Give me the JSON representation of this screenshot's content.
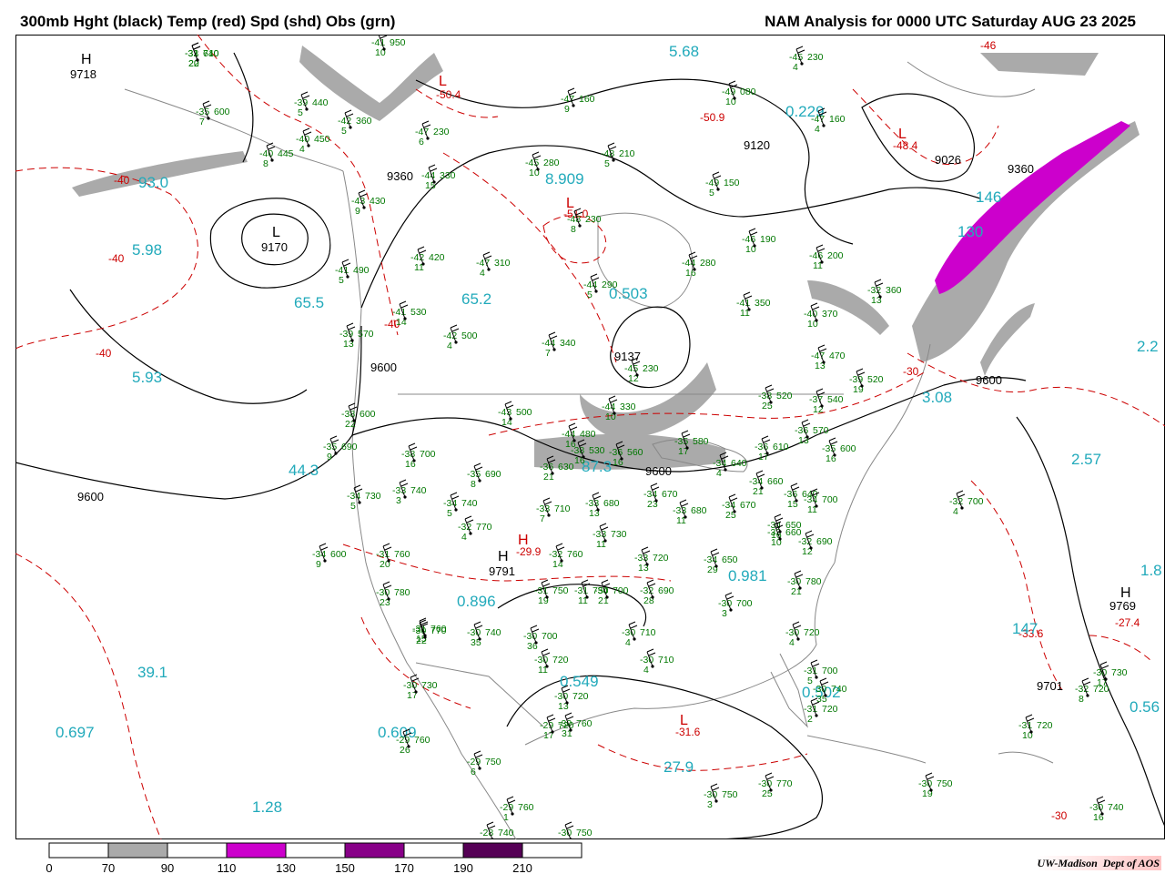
{
  "header": {
    "left_title": "300mb Hght (black) Temp (red) Spd (shd) Obs (grn)",
    "right_title": "NAM Analysis for 0000 UTC Saturday  AUG 23 2025"
  },
  "credit": {
    "org": "UW-Madison",
    "dept": "Dept of AOS"
  },
  "colors": {
    "height_contour": "#000000",
    "temp_contour": "#cc0000",
    "speed_70_90": "#aaaaaa",
    "speed_110_130": "#cc00cc",
    "speed_150_170": "#880088",
    "speed_190_210": "#550055",
    "obs": "#007700",
    "speed_label": "#22aabb",
    "geography": "#888888"
  },
  "scale_bar": {
    "labels": [
      "0",
      "70",
      "90",
      "110",
      "130",
      "150",
      "170",
      "190",
      "210"
    ],
    "segment_colors": [
      "#ffffff",
      "#aaaaaa",
      "#ffffff",
      "#cc00cc",
      "#ffffff",
      "#880088",
      "#ffffff",
      "#550055",
      "#ffffff"
    ]
  },
  "height_labels": [
    {
      "text": "9718"
    },
    {
      "text": "9360"
    },
    {
      "text": "9170"
    },
    {
      "text": "9600"
    },
    {
      "text": "9600"
    },
    {
      "text": "9137"
    },
    {
      "text": "9120"
    },
    {
      "text": "9026"
    },
    {
      "text": "9360"
    },
    {
      "text": "9600"
    },
    {
      "text": "9600"
    },
    {
      "text": "9791"
    },
    {
      "text": "9701"
    },
    {
      "text": "9769"
    }
  ],
  "hl_markers": [
    {
      "text": "H",
      "kind": "height"
    },
    {
      "text": "L",
      "kind": "height"
    },
    {
      "text": "H",
      "kind": "height"
    },
    {
      "text": "H",
      "kind": "height"
    },
    {
      "text": "L",
      "kind": "temp"
    },
    {
      "text": "L",
      "kind": "temp"
    },
    {
      "text": "H",
      "kind": "temp"
    },
    {
      "text": "L",
      "kind": "temp"
    },
    {
      "text": "L",
      "kind": "temp"
    }
  ],
  "temp_labels": [
    {
      "text": "-40"
    },
    {
      "text": "-40"
    },
    {
      "text": "-40"
    },
    {
      "text": "-40"
    },
    {
      "text": "-50.4"
    },
    {
      "text": "-50.9"
    },
    {
      "text": "-51.0"
    },
    {
      "text": "-48.4"
    },
    {
      "text": "-46"
    },
    {
      "text": "-29.9"
    },
    {
      "text": "-31.6"
    },
    {
      "text": "-33.6"
    },
    {
      "text": "-27.4"
    },
    {
      "text": "-30"
    },
    {
      "text": "-30"
    }
  ],
  "speed_labels": [
    {
      "text": "93.0"
    },
    {
      "text": "5.98"
    },
    {
      "text": "65.5"
    },
    {
      "text": "5.93"
    },
    {
      "text": "65.2"
    },
    {
      "text": "8.909"
    },
    {
      "text": "0.229"
    },
    {
      "text": "146"
    },
    {
      "text": "130"
    },
    {
      "text": "0.503"
    },
    {
      "text": "3.08"
    },
    {
      "text": "2.57"
    },
    {
      "text": "44.3"
    },
    {
      "text": "87.3"
    },
    {
      "text": "0.896"
    },
    {
      "text": "0.981"
    },
    {
      "text": "39.1"
    },
    {
      "text": "0.697"
    },
    {
      "text": "0.609"
    },
    {
      "text": "1.28"
    },
    {
      "text": "0.549"
    },
    {
      "text": "27.9"
    },
    {
      "text": "0.502"
    },
    {
      "text": "147"
    },
    {
      "text": "5.68"
    },
    {
      "text": "2.2"
    },
    {
      "text": "1.8"
    },
    {
      "text": "0.56"
    }
  ],
  "stations": [
    {
      "t": "-33",
      "v": "640",
      "s": "20"
    },
    {
      "t": "-41",
      "v": "950",
      "s": "10"
    },
    {
      "t": "-39",
      "v": "440",
      "s": "5"
    },
    {
      "t": "-35",
      "v": "600",
      "s": "7"
    },
    {
      "t": "-42",
      "v": "360",
      "s": "5"
    },
    {
      "t": "-40",
      "v": "450",
      "s": "4"
    },
    {
      "t": "-40",
      "v": "445",
      "s": "8"
    },
    {
      "t": "-47",
      "v": "230",
      "s": "6"
    },
    {
      "t": "-47",
      "v": "160",
      "s": "9"
    },
    {
      "t": "-45",
      "v": "230",
      "s": "4"
    },
    {
      "t": "-49",
      "v": "080",
      "s": "10"
    },
    {
      "t": "-47",
      "v": "160",
      "s": "4"
    },
    {
      "t": "-45",
      "v": "280",
      "s": "10"
    },
    {
      "t": "-48",
      "v": "210",
      "s": "5"
    },
    {
      "t": "-44",
      "v": "330",
      "s": "15"
    },
    {
      "t": "-43",
      "v": "430",
      "s": "9"
    },
    {
      "t": "-48",
      "v": "230",
      "s": "8"
    },
    {
      "t": "-49",
      "v": "150",
      "s": "5"
    },
    {
      "t": "-46",
      "v": "190",
      "s": "10"
    },
    {
      "t": "-42",
      "v": "420",
      "s": "11"
    },
    {
      "t": "-47",
      "v": "310",
      "s": "4"
    },
    {
      "t": "-44",
      "v": "280",
      "s": "16"
    },
    {
      "t": "-46",
      "v": "200",
      "s": "11"
    },
    {
      "t": "-41",
      "v": "490",
      "s": "5"
    },
    {
      "t": "-44",
      "v": "290",
      "s": "5"
    },
    {
      "t": "-41",
      "v": "530",
      "s": "14"
    },
    {
      "t": "-42",
      "v": "500",
      "s": "4"
    },
    {
      "t": "-44",
      "v": "340",
      "s": "7"
    },
    {
      "t": "-41",
      "v": "350",
      "s": "11"
    },
    {
      "t": "-40",
      "v": "370",
      "s": "10"
    },
    {
      "t": "-32",
      "v": "360",
      "s": "13"
    },
    {
      "t": "-39",
      "v": "570",
      "s": "13"
    },
    {
      "t": "-45",
      "v": "230",
      "s": "12"
    },
    {
      "t": "-47",
      "v": "470",
      "s": "13"
    },
    {
      "t": "-39",
      "v": "520",
      "s": "19"
    },
    {
      "t": "-38",
      "v": "600",
      "s": "22"
    },
    {
      "t": "-43",
      "v": "500",
      "s": "14"
    },
    {
      "t": "-44",
      "v": "330",
      "s": "10"
    },
    {
      "t": "-38",
      "v": "520",
      "s": "25"
    },
    {
      "t": "-37",
      "v": "540",
      "s": "12"
    },
    {
      "t": "-35",
      "v": "690",
      "s": "9"
    },
    {
      "t": "-38",
      "v": "700",
      "s": "16"
    },
    {
      "t": "-44",
      "v": "480",
      "s": "16"
    },
    {
      "t": "-38",
      "v": "530",
      "s": "16"
    },
    {
      "t": "-36",
      "v": "560",
      "s": "16"
    },
    {
      "t": "-35",
      "v": "580",
      "s": "17"
    },
    {
      "t": "-36",
      "v": "610",
      "s": "17"
    },
    {
      "t": "-36",
      "v": "570",
      "s": "13"
    },
    {
      "t": "-35",
      "v": "600",
      "s": "16"
    },
    {
      "t": "-35",
      "v": "690",
      "s": "8"
    },
    {
      "t": "-36",
      "v": "630",
      "s": "21"
    },
    {
      "t": "-34",
      "v": "640",
      "s": "4"
    },
    {
      "t": "-34",
      "v": "730",
      "s": "5"
    },
    {
      "t": "-33",
      "v": "740",
      "s": "3"
    },
    {
      "t": "-34",
      "v": "740",
      "s": "5"
    },
    {
      "t": "-34",
      "v": "670",
      "s": "23"
    },
    {
      "t": "-34",
      "v": "660",
      "s": "21"
    },
    {
      "t": "-36",
      "v": "640",
      "s": "15"
    },
    {
      "t": "-34",
      "v": "700",
      "s": "11"
    },
    {
      "t": "-32",
      "v": "770",
      "s": "4"
    },
    {
      "t": "-33",
      "v": "710",
      "s": "7"
    },
    {
      "t": "-33",
      "v": "680",
      "s": "13"
    },
    {
      "t": "-33",
      "v": "730",
      "s": "11"
    },
    {
      "t": "-33",
      "v": "680",
      "s": "11"
    },
    {
      "t": "-34",
      "v": "670",
      "s": "25"
    },
    {
      "t": "-34",
      "v": "650",
      "s": "16"
    },
    {
      "t": "-32",
      "v": "700",
      "s": "4"
    },
    {
      "t": "-34",
      "v": "600",
      "s": "9"
    },
    {
      "t": "-31",
      "v": "760",
      "s": "20"
    },
    {
      "t": "-32",
      "v": "760",
      "s": "14"
    },
    {
      "t": "-33",
      "v": "720",
      "s": "13"
    },
    {
      "t": "-34",
      "v": "650",
      "s": "29"
    },
    {
      "t": "-33",
      "v": "660",
      "s": "10"
    },
    {
      "t": "-32",
      "v": "690",
      "s": "12"
    },
    {
      "t": "-31",
      "v": "750",
      "s": "11"
    },
    {
      "t": "-30",
      "v": "780",
      "s": "23"
    },
    {
      "t": "-31",
      "v": "760",
      "s": "15"
    },
    {
      "t": "-31",
      "v": "750",
      "s": "19"
    },
    {
      "t": "-34",
      "v": "700",
      "s": "21"
    },
    {
      "t": "-32",
      "v": "690",
      "s": "28"
    },
    {
      "t": "-30",
      "v": "700",
      "s": "3"
    },
    {
      "t": "-30",
      "v": "780",
      "s": "21"
    },
    {
      "t": "-30",
      "v": "770",
      "s": "22"
    },
    {
      "t": "-30",
      "v": "740",
      "s": "35"
    },
    {
      "t": "-30",
      "v": "700",
      "s": "36"
    },
    {
      "t": "-30",
      "v": "710",
      "s": "4"
    },
    {
      "t": "-30",
      "v": "710",
      "s": "4"
    },
    {
      "t": "-30",
      "v": "720",
      "s": "4"
    },
    {
      "t": "-31",
      "v": "700",
      "s": "5"
    },
    {
      "t": "-30",
      "v": "740",
      "s": "35"
    },
    {
      "t": "-31",
      "v": "720",
      "s": "2"
    },
    {
      "t": "-30",
      "v": "720",
      "s": "11"
    },
    {
      "t": "-30",
      "v": "720",
      "s": "13"
    },
    {
      "t": "-30",
      "v": "760",
      "s": "31"
    },
    {
      "t": "-30",
      "v": "730",
      "s": "17"
    },
    {
      "t": "-29",
      "v": "720",
      "s": "17"
    },
    {
      "t": "-29",
      "v": "760",
      "s": "26"
    },
    {
      "t": "-29",
      "v": "750",
      "s": "6"
    },
    {
      "t": "-29",
      "v": "760",
      "s": "1"
    },
    {
      "t": "-28",
      "v": "740",
      "s": "3"
    },
    {
      "t": "-30",
      "v": "750",
      "s": "3"
    },
    {
      "t": "-30",
      "v": "750",
      "s": "3"
    },
    {
      "t": "-30",
      "v": "770",
      "s": "25"
    },
    {
      "t": "-30",
      "v": "750",
      "s": "19"
    },
    {
      "t": "-31",
      "v": "720",
      "s": "10"
    },
    {
      "t": "-32",
      "v": "720",
      "s": "8"
    },
    {
      "t": "-30",
      "v": "730",
      "s": "17"
    },
    {
      "t": "-30",
      "v": "740",
      "s": "16"
    },
    {
      "t": "-31",
      "v": "710",
      "s": "22"
    }
  ]
}
